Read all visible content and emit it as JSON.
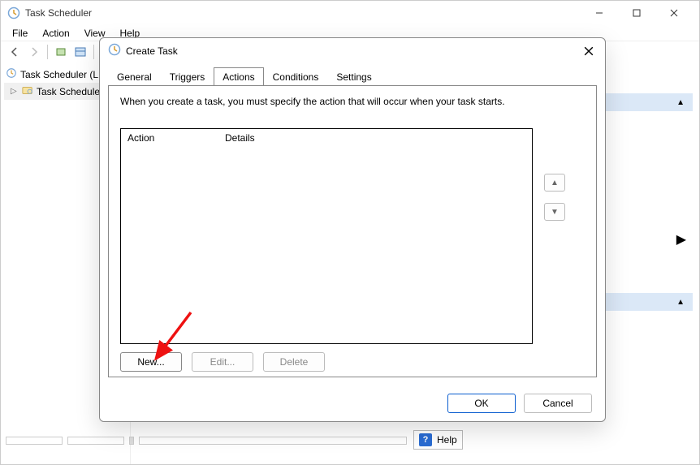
{
  "app": {
    "title": "Task Scheduler"
  },
  "menu": {
    "file": "File",
    "action": "Action",
    "view": "View",
    "help": "Help"
  },
  "tree": {
    "root": "Task Scheduler (L",
    "library": "Task Schedule"
  },
  "helpbar": {
    "label": "Help"
  },
  "dialog": {
    "title": "Create Task",
    "tabs": {
      "general": "General",
      "triggers": "Triggers",
      "actions": "Actions",
      "conditions": "Conditions",
      "settings": "Settings"
    },
    "desc": "When you create a task, you must specify the action that will occur when your task starts.",
    "columns": {
      "action": "Action",
      "details": "Details"
    },
    "buttons": {
      "new": "New...",
      "edit": "Edit...",
      "delete": "Delete",
      "ok": "OK",
      "cancel": "Cancel"
    }
  }
}
